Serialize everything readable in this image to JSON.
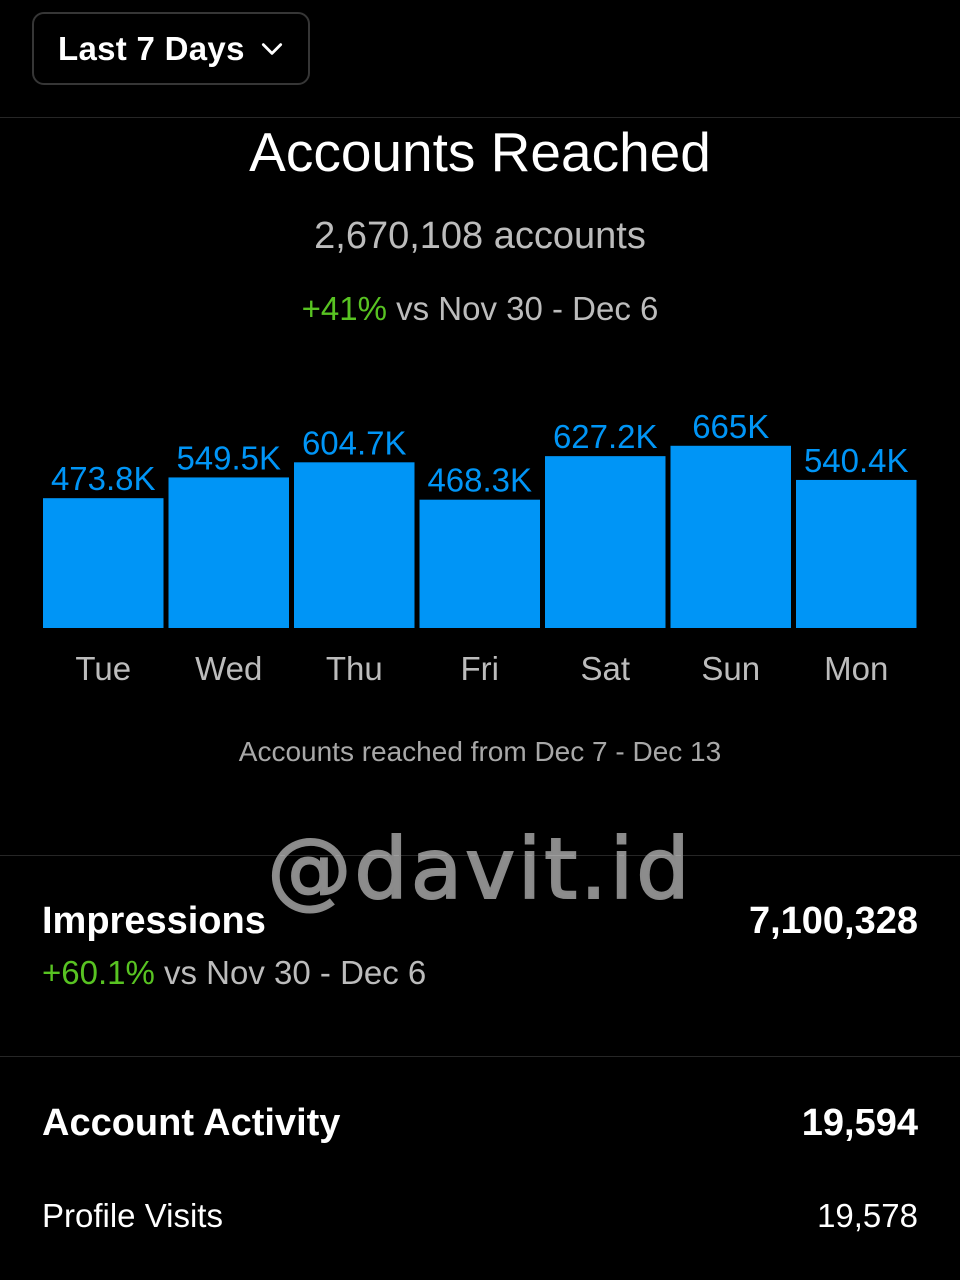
{
  "range_selector": {
    "label": "Last 7 Days",
    "icon": "chevron-down-icon"
  },
  "accounts_reached": {
    "title": "Accounts Reached",
    "total": "2,670,108 accounts",
    "change": "+41%",
    "comparison": "vs Nov 30 - Dec 6",
    "footnote": "Accounts reached from Dec 7 - Dec 13"
  },
  "chart_data": {
    "type": "bar",
    "categories": [
      "Tue",
      "Wed",
      "Thu",
      "Fri",
      "Sat",
      "Sun",
      "Mon"
    ],
    "values": [
      473.8,
      549.5,
      604.7,
      468.3,
      627.2,
      665,
      540.4
    ],
    "value_labels": [
      "473.8K",
      "549.5K",
      "604.7K",
      "468.3K",
      "627.2K",
      "665K",
      "540.4K"
    ],
    "unit": "K",
    "title": "",
    "xlabel": "",
    "ylabel": "",
    "grid": false,
    "bar_color": "#0095f6",
    "label_color": "#0095f6"
  },
  "watermark": "@davit.id",
  "impressions": {
    "title": "Impressions",
    "value": "7,100,328",
    "change": "+60.1%",
    "comparison": "vs Nov 30 - Dec 6"
  },
  "account_activity": {
    "title": "Account Activity",
    "value": "19,594"
  },
  "profile_visits": {
    "title": "Profile Visits",
    "value": "19,578"
  },
  "colors": {
    "accent": "#0095f6",
    "positive": "#58c322",
    "background": "#000000"
  }
}
